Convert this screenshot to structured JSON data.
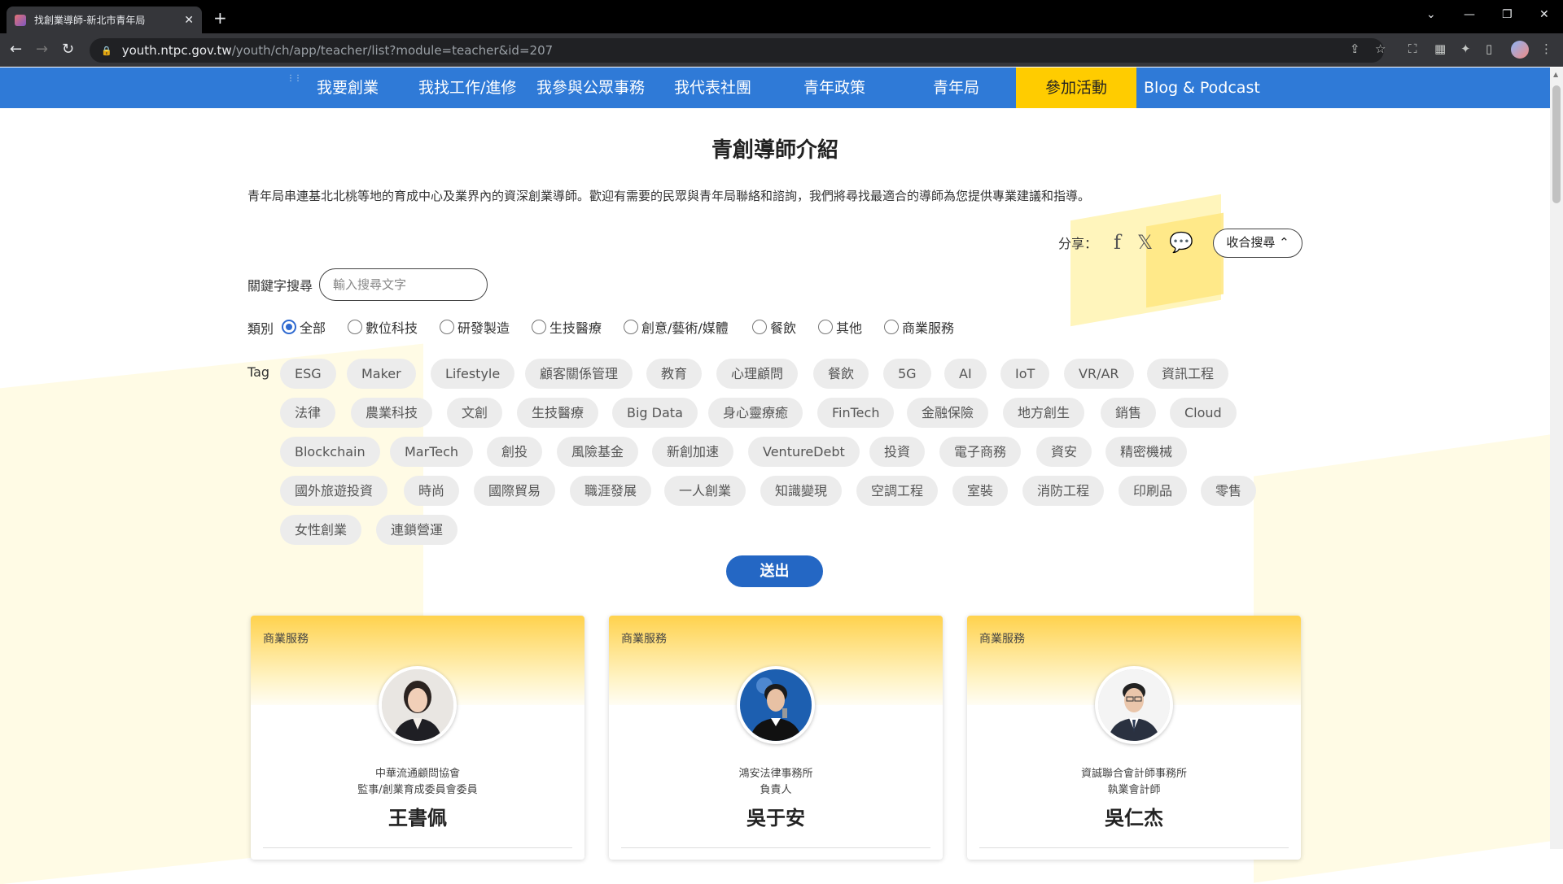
{
  "browser": {
    "tab_title": "找創業導師-新北市青年局",
    "url_host": "youth.ntpc.gov.tw",
    "url_path": "/youth/ch/app/teacher/list?module=teacher&id=207"
  },
  "nav": {
    "items": [
      "我要創業",
      "我找工作/進修",
      "我參與公眾事務",
      "我代表社團",
      "青年政策",
      "青年局",
      "參加活動",
      "Blog & Podcast"
    ],
    "active": "參加活動",
    "handle": "⋮⋮"
  },
  "page": {
    "title": "青創導師介紹",
    "intro": "青年局串連基北北桃等地的育成中心及業界內的資深創業導師。歡迎有需要的民眾與青年局聯絡和諮詢，我們將尋找最適合的導師為您提供專業建議和指導。",
    "share_label": "分享：",
    "collapse_label": "收合搜尋 ⌃"
  },
  "search": {
    "keyword_label": "關鍵字搜尋",
    "placeholder": "輸入搜尋文字",
    "category_label": "類別",
    "categories": [
      "全部",
      "數位科技",
      "研發製造",
      "生技醫療",
      "創意/藝術/媒體",
      "餐飲",
      "其他",
      "商業服務"
    ],
    "selected_category": "全部",
    "tag_label": "Tag",
    "tags": [
      [
        "ESG",
        "Maker",
        "Lifestyle",
        "顧客關係管理",
        "教育",
        "心理顧問",
        "餐飲",
        "5G",
        "AI",
        "IoT",
        "VR/AR",
        "資訊工程"
      ],
      [
        "法律",
        "農業科技",
        "文創",
        "生技醫療",
        "Big Data",
        "身心靈療癒",
        "FinTech",
        "金融保險",
        "地方創生",
        "銷售",
        "Cloud"
      ],
      [
        "Blockchain",
        "MarTech",
        "創投",
        "風險基金",
        "新創加速",
        "VentureDebt",
        "投資",
        "電子商務",
        "資安",
        "精密機械"
      ],
      [
        "國外旅遊投資",
        "時尚",
        "國際貿易",
        "職涯發展",
        "一人創業",
        "知識變現",
        "空調工程",
        "室裝",
        "消防工程",
        "印刷品",
        "零售"
      ],
      [
        "女性創業",
        "連鎖營運"
      ]
    ],
    "submit_label": "送出"
  },
  "mentors": [
    {
      "category": "商業服務",
      "org": "中華流通顧問協會",
      "role": "監事/創業育成委員會委員",
      "name": "王書佩"
    },
    {
      "category": "商業服務",
      "org": "鴻安法律事務所",
      "role": "負責人",
      "name": "吳于安"
    },
    {
      "category": "商業服務",
      "org": "資誠聯合會計師事務所",
      "role": "執業會計師",
      "name": "吳仁杰"
    }
  ],
  "colors": {
    "nav_bg": "#2f7ad7",
    "nav_active": "#ffcc00",
    "submit_bg": "#2467c4",
    "card_top": "#ffd24d"
  }
}
